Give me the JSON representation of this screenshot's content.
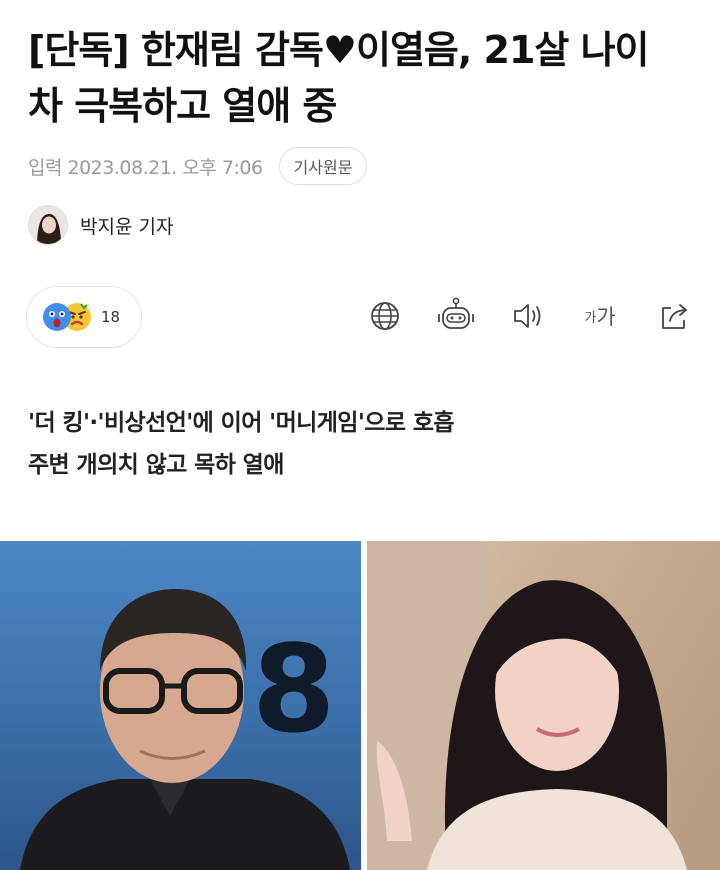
{
  "article": {
    "headline": "[단독] 한재림 감독♥이열음, 21살 나이 차 극복하고 열애 중",
    "published": "입력 2023.08.21. 오후 7:06",
    "original_label": "기사원문",
    "author": "박지윤 기자",
    "reactions": {
      "count": "18",
      "icons": [
        "surprised-emoji",
        "angry-emoji"
      ]
    },
    "tools": [
      "globe-icon",
      "robot-icon",
      "speaker-icon",
      "font-size-icon",
      "share-icon"
    ],
    "font_tool_small": "가",
    "font_tool_big": "가",
    "subheadings": [
      "'더 킹'·'비상선언'에 이어 '머니게임'으로 호흡",
      "주변 개의치 않고 목하 열애"
    ],
    "photo_text": "8"
  },
  "colors": {
    "text": "#111111",
    "meta": "#9a9a9a",
    "border": "#e3e3e3"
  }
}
